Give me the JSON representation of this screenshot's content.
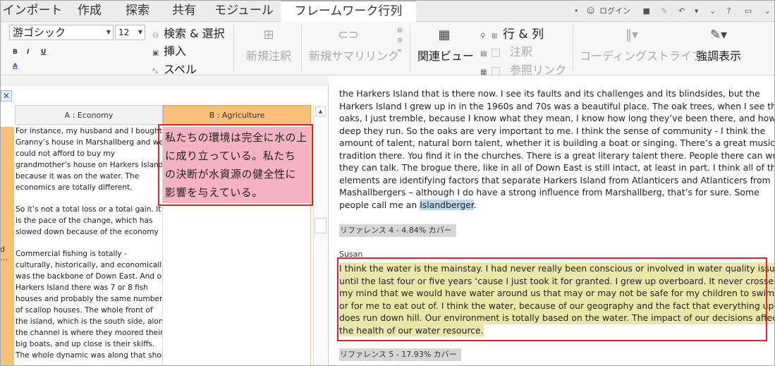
{
  "tabs": [
    {
      "label": "インポート"
    },
    {
      "label": "作成"
    },
    {
      "label": "探索"
    },
    {
      "label": "共有"
    },
    {
      "label": "モジュール"
    },
    {
      "label": "フレームワーク行列"
    }
  ],
  "quick_access": {
    "login_label": "ログイン"
  },
  "ribbon": {
    "font_name": "游ゴシック",
    "font_size": "12",
    "search_replace": "検索 & 選択",
    "insert": "挿入",
    "spell": "スペル",
    "new_annotation": "新規注釈",
    "new_summary_link": "新規サマリリンク",
    "related_view": "関連ビュー",
    "row_col": "行 & 列",
    "annotation": "注釈",
    "see_also_link": "参照リンク",
    "coding_stripes": "コーディングストライプ",
    "highlight": "強調表示"
  },
  "matrix": {
    "col_a_header": "A : Economy",
    "col_b_header": "B : Agriculture",
    "row_label_partial": "d",
    "row_label_more": "…",
    "cell_a_paragraphs": [
      "For instance, my husband and I bought\nGranny’s house in Marshallberg and we\ncould not afford to buy my\ngrandmother’s house on Harkers Island\nbecause it was on the water. The\neconomics are totally different.",
      "So it’s not a total loss or a total gain. It\nis the pace of the change, which has\nslowed down because of the economy",
      "Commercial fishing is totally -\nculturally, historically, and economically\nwas the backbone of Down East. And on\nHarkers Island there was 7 or 8 fish\nhouses and probably the same number\nof scallop houses. The whole front of\nthe island, which is the south side, along\nthe channel is where they moored their\nbig boats, and up close is their skiffs.\nThe whole dynamic was along that shore"
    ],
    "cell_b_text": "私たちの環境は完全に水の上\nに成り立っている。私たち\nの決断が水資源の健全性に\n影響を与えている。"
  },
  "document": {
    "lines": [
      "the Harkers Island that is there now. I see its faults and its challenges and its blindsides, but the",
      "Harkers Island I grew up in in the 1960s and 70s was a beautiful place. The oak trees, when I see those",
      "oaks, I just tremble, because I know what they mean, I know how long they’ve been there, and how",
      "deep they run. So the oaks are very important to me. I think the sense of community - I think the",
      "amount of talent, natural born talent, whether it is building a boat or singing. There’s a great music",
      "tradition there. You find it in the churches. There is a great literary talent there. People there can write,",
      "they can talk. The brogue there, like in all of Down East is still intact, at least in part. I think all of those",
      "elements are identifying factors that separate Harkers Island from Atlanticers and Atlanticers from",
      "Mashallbergers – although I do have a strong influence from Marshallberg, that’s for sure. Some"
    ],
    "last_line_prefix": "people call me an ",
    "highlighted_word": "Islandberger",
    "last_line_suffix": ".",
    "reference4": "リファレンス 4 - 4.84% カバー",
    "speaker": "Susan",
    "highlighted_lines": [
      "I think the water is the mainstay. I had never really been conscious or involved in water quality issues",
      "until the last four or five years ‘cause I just took it for granted. I grew up overboard. It never crossed",
      "my mind that we would have water around us that may or may not be safe for my children to swim in",
      "or for me to eat out of. I think the water, because of our geography and the fact that everything uphill",
      "does run down hill. Our environment is totally based on the water. The impact of our decisions affects",
      "the health of our water resource."
    ],
    "reference5": "リファレンス 5 - 17.93% カバー"
  }
}
